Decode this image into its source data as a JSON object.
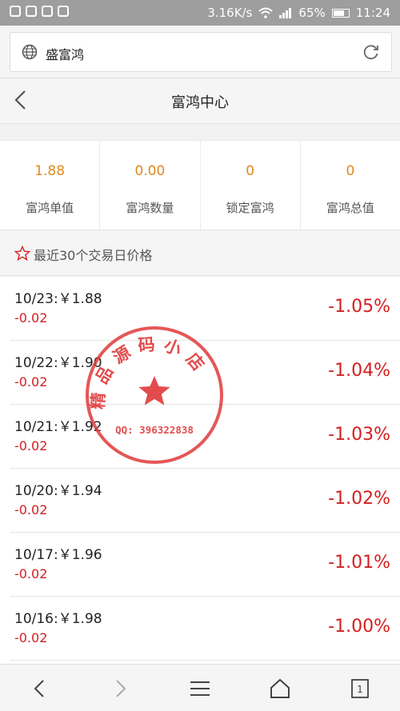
{
  "status_bar": {
    "network_speed": "3.16K/s",
    "battery": "65%",
    "time": "11:24"
  },
  "browser": {
    "url_title": "盛富鸿"
  },
  "header": {
    "title": "富鸿中心"
  },
  "stats": [
    {
      "value": "1.88",
      "label": "富鸿单值"
    },
    {
      "value": "0.00",
      "label": "富鸿数量"
    },
    {
      "value": "0",
      "label": "锁定富鸿"
    },
    {
      "value": "0",
      "label": "富鸿总值"
    }
  ],
  "section": {
    "title": "最近30个交易日价格"
  },
  "prices": [
    {
      "date_price": "10/23:￥1.88",
      "change": "-0.02",
      "percent": "-1.05%"
    },
    {
      "date_price": "10/22:￥1.90",
      "change": "-0.02",
      "percent": "-1.04%"
    },
    {
      "date_price": "10/21:￥1.92",
      "change": "-0.02",
      "percent": "-1.03%"
    },
    {
      "date_price": "10/20:￥1.94",
      "change": "-0.02",
      "percent": "-1.02%"
    },
    {
      "date_price": "10/17:￥1.96",
      "change": "-0.02",
      "percent": "-1.01%"
    },
    {
      "date_price": "10/16:￥1.98",
      "change": "-0.02",
      "percent": "-1.00%"
    }
  ],
  "stamp": {
    "text": "精品源码小店",
    "qq": "QQ: 396322838"
  },
  "bottom_nav": {
    "tab_count": "1"
  },
  "colors": {
    "accent_orange": "#e08a1e",
    "negative_red": "#d42020",
    "stamp_red": "#e0393a"
  }
}
